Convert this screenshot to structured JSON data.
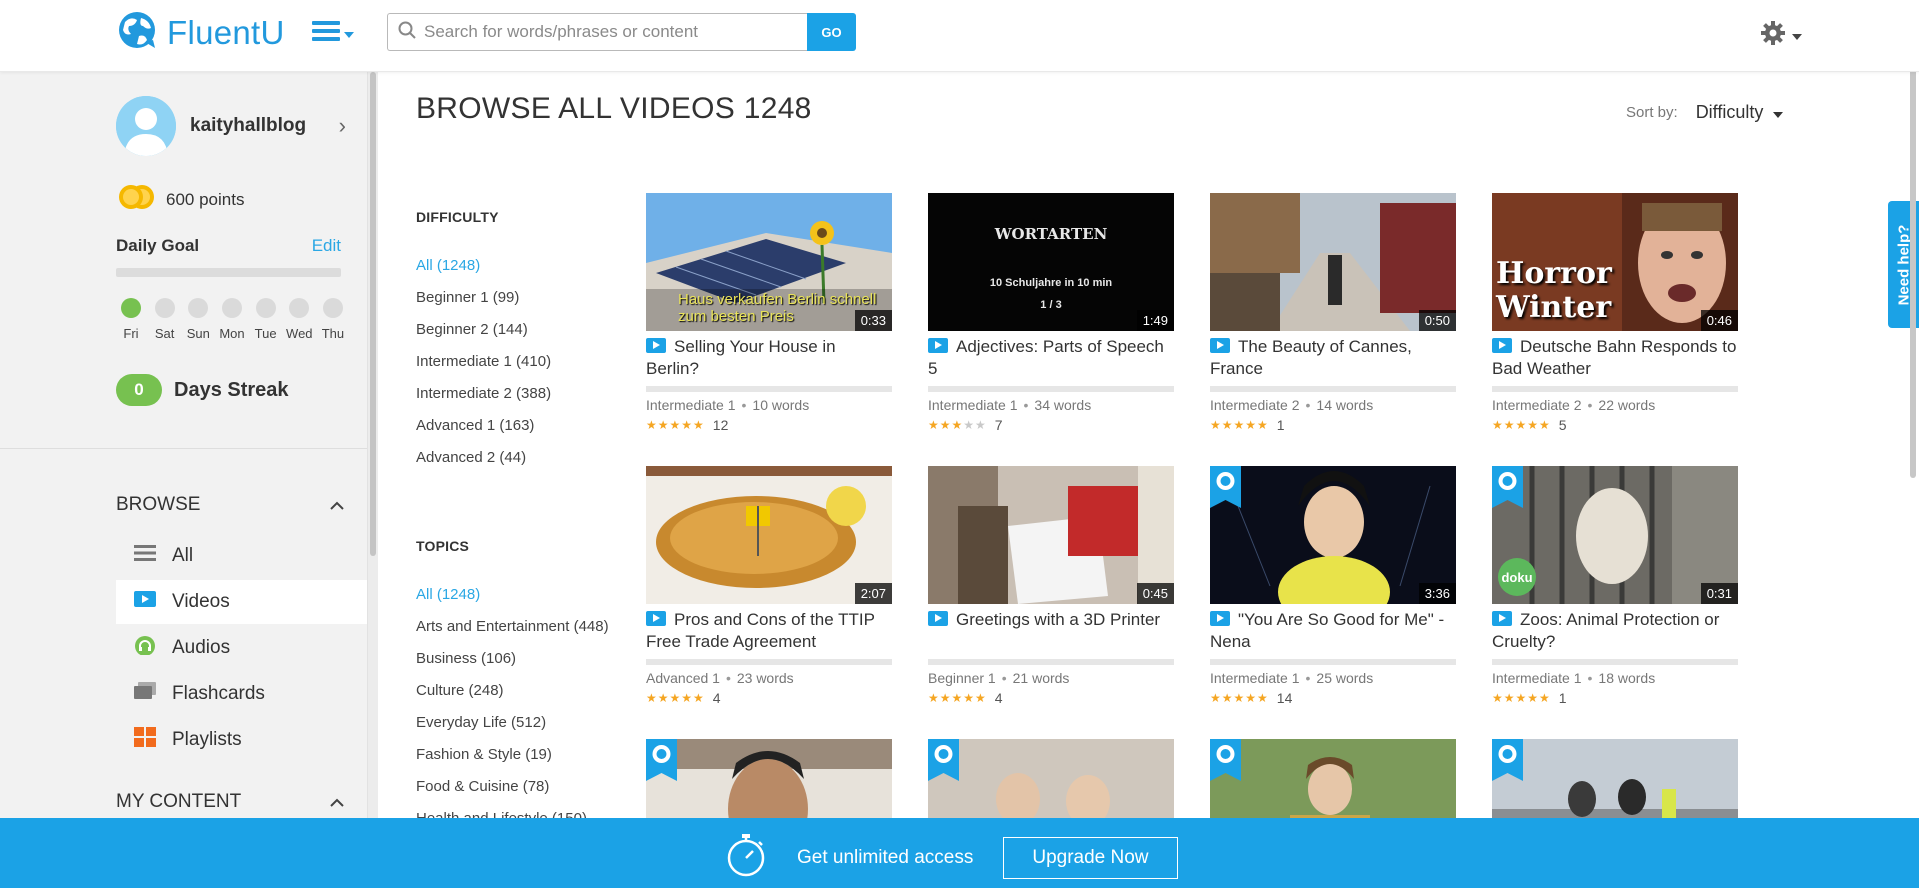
{
  "header": {
    "logo_text": "FluentU",
    "search_placeholder": "Search for words/phrases or content",
    "search_button": "GO",
    "icons": {
      "logo": "globe-logo-icon",
      "menu": "hamburger-menu-icon",
      "search": "search-icon",
      "settings": "gear-icon"
    }
  },
  "sidebar": {
    "username": "kaityhallblog",
    "points": "600 points",
    "daily_goal_label": "Daily Goal",
    "daily_goal_edit": "Edit",
    "days": [
      "Fri",
      "Sat",
      "Sun",
      "Mon",
      "Tue",
      "Wed",
      "Thu"
    ],
    "streak_count": "0",
    "streak_label": "Days Streak",
    "browse_heading": "BROWSE",
    "my_content_heading": "MY CONTENT",
    "nav": [
      {
        "label": "All",
        "icon": "list-icon"
      },
      {
        "label": "Videos",
        "icon": "video-icon"
      },
      {
        "label": "Audios",
        "icon": "headphones-icon"
      },
      {
        "label": "Flashcards",
        "icon": "flashcards-icon"
      },
      {
        "label": "Playlists",
        "icon": "grid-icon"
      }
    ]
  },
  "main": {
    "title": "BROWSE ALL VIDEOS 1248",
    "sort_label": "Sort by:",
    "sort_value": "Difficulty",
    "difficulty_heading": "DIFFICULTY",
    "difficulty": [
      "All (1248)",
      "Beginner 1 (99)",
      "Beginner 2 (144)",
      "Intermediate 1 (410)",
      "Intermediate 2 (388)",
      "Advanced 1 (163)",
      "Advanced 2 (44)"
    ],
    "topics_heading": "TOPICS",
    "topics": [
      "All (1248)",
      "Arts and Entertainment (448)",
      "Business (106)",
      "Culture (248)",
      "Everyday Life (512)",
      "Fashion & Style (19)",
      "Food & Cuisine (78)",
      "Health and Lifestyle (150)"
    ]
  },
  "videos": [
    {
      "title": "Selling Your House in Berlin?",
      "duration": "0:33",
      "level": "Intermediate 1",
      "words": "10 words",
      "rating": 4.5,
      "reviews": "12",
      "thumb_caption": "Haus verkaufen Berlin schnell zum besten Preis"
    },
    {
      "title": "Adjectives: Parts of Speech 5",
      "duration": "1:49",
      "level": "Intermediate 1",
      "words": "34 words",
      "rating": 3,
      "reviews": "7",
      "thumb_caption": "WORTARTEN",
      "thumb_caption2": "10 Schuljahre in 10 min",
      "thumb_caption3": "1 / 3"
    },
    {
      "title": "The Beauty of Cannes, France",
      "duration": "0:50",
      "level": "Intermediate 2",
      "words": "14 words",
      "rating": 5,
      "reviews": "1"
    },
    {
      "title": "Deutsche Bahn Responds to Bad Weather",
      "duration": "0:46",
      "level": "Intermediate 2",
      "words": "22 words",
      "rating": 4.5,
      "reviews": "5",
      "thumb_caption": "Horror Winter"
    },
    {
      "title": "Pros and Cons of the TTIP Free Trade Agreement",
      "duration": "2:07",
      "level": "Advanced 1",
      "words": "23 words",
      "rating": 5,
      "reviews": "4"
    },
    {
      "title": "Greetings with a 3D Printer",
      "duration": "0:45",
      "level": "Beginner 1",
      "words": "21 words",
      "rating": 5,
      "reviews": "4"
    },
    {
      "title": "\"You Are So Good for Me\" - Nena",
      "duration": "3:36",
      "level": "Intermediate 1",
      "words": "25 words",
      "rating": 5,
      "reviews": "14"
    },
    {
      "title": "Zoos: Animal Protection or Cruelty?",
      "duration": "0:31",
      "level": "Intermediate 1",
      "words": "18 words",
      "rating": 5,
      "reviews": "1",
      "thumb_caption": "doku"
    }
  ],
  "help_tab": "Need help?",
  "upgrade": {
    "text": "Get unlimited access",
    "button": "Upgrade Now",
    "icon": "stopwatch-icon"
  },
  "colors": {
    "accent": "#1ba2e6",
    "streak": "#77c150",
    "star": "#f5a623",
    "playlist": "#f26b1d"
  }
}
